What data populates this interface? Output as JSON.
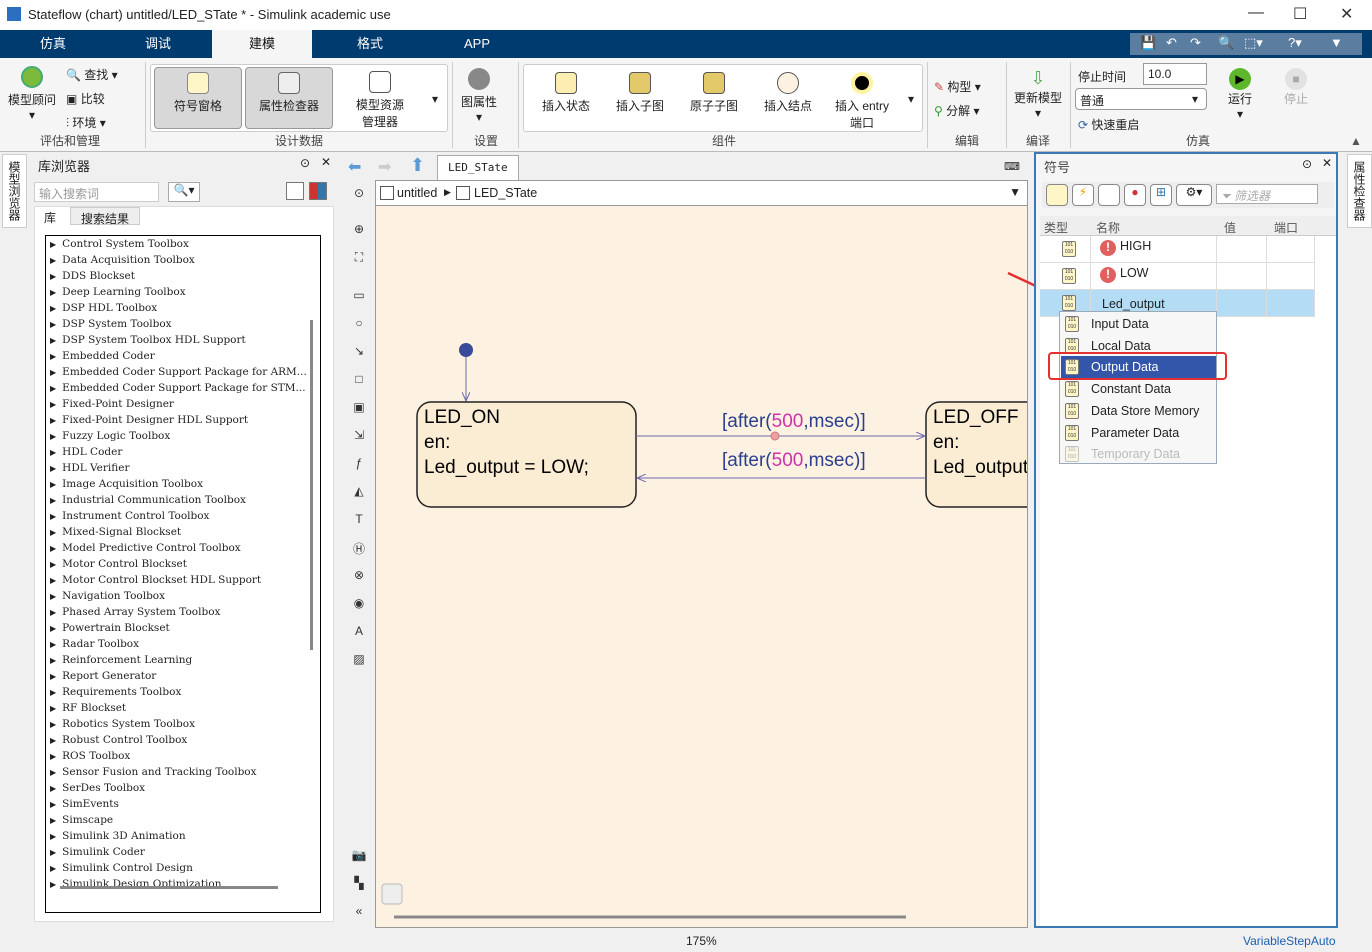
{
  "window": {
    "title": "Stateflow (chart) untitled/LED_STate * - Simulink academic use",
    "controls": [
      "minimize",
      "maximize",
      "close"
    ]
  },
  "tabs": [
    {
      "label": "仿真"
    },
    {
      "label": "调试"
    },
    {
      "label": "建模",
      "active": true
    },
    {
      "label": "格式"
    },
    {
      "label": "APP"
    }
  ],
  "ribbon": {
    "assess": {
      "advisor": "模型顾问",
      "find": "查找",
      "compare": "比较",
      "env": "环境",
      "group": "评估和管理"
    },
    "design": {
      "symbols": "符号窗格",
      "inspector": "属性检查器",
      "explorer1": "模型资源",
      "explorer2": "管理器",
      "group": "设计数据"
    },
    "setup": {
      "props": "图属性",
      "group": "设置"
    },
    "components": {
      "state": "插入状态",
      "subchart": "插入子图",
      "atomic": "原子子图",
      "junction": "插入结点",
      "entry1": "插入 entry",
      "entry2": "端口",
      "group": "组件"
    },
    "edit": {
      "pattern": "构型",
      "decompose": "分解",
      "group": "编辑"
    },
    "compile": {
      "update": "更新模型",
      "group": "编译"
    },
    "sim": {
      "stop_time_label": "停止时间",
      "stop_time": "10.0",
      "mode": "普通",
      "fast_restart": "快速重启",
      "run": "运行",
      "stop": "停止",
      "group": "仿真"
    }
  },
  "left_strip": {
    "model_browser": "模型浏览器"
  },
  "library": {
    "title": "库浏览器",
    "search_placeholder": "输入搜索词",
    "tabs": [
      "库",
      "搜索结果"
    ],
    "items": [
      "Control System Toolbox",
      "Data Acquisition Toolbox",
      "DDS Blockset",
      "Deep Learning Toolbox",
      "DSP HDL Toolbox",
      "DSP System Toolbox",
      "DSP System Toolbox HDL Support",
      "Embedded Coder",
      "Embedded Coder Support Package for ARM...",
      "Embedded Coder Support Package for STM...",
      "Fixed-Point Designer",
      "Fixed-Point Designer HDL Support",
      "Fuzzy Logic Toolbox",
      "HDL Coder",
      "HDL Verifier",
      "Image Acquisition Toolbox",
      "Industrial Communication Toolbox",
      "Instrument Control Toolbox",
      "Mixed-Signal Blockset",
      "Model Predictive Control Toolbox",
      "Motor Control Blockset",
      "Motor Control Blockset HDL Support",
      "Navigation Toolbox",
      "Phased Array System Toolbox",
      "Powertrain Blockset",
      "Radar Toolbox",
      "Reinforcement Learning",
      "Report Generator",
      "Requirements Toolbox",
      "RF Blockset",
      "Robotics System Toolbox",
      "Robust Control Toolbox",
      "ROS Toolbox",
      "Sensor Fusion and Tracking Toolbox",
      "SerDes Toolbox",
      "SimEvents",
      "Simscape",
      "Simulink 3D Animation",
      "Simulink Coder",
      "Simulink Control Design",
      "Simulink Design Optimization"
    ]
  },
  "editor": {
    "tab": "LED_STate",
    "breadcrumb": [
      "untitled",
      "LED_STate"
    ],
    "zoom": "175%",
    "states": [
      {
        "name": "LED_ON",
        "body1": "en:",
        "body2": "Led_output = LOW;"
      },
      {
        "name": "LED_OFF",
        "body1": "en:",
        "body2": "Led_output"
      }
    ],
    "transition": {
      "pre": "[after(",
      "num": "500",
      "post": ",msec)]"
    }
  },
  "symbols": {
    "title": "符号",
    "filter_placeholder": "筛选器",
    "columns": [
      "类型",
      "名称",
      "值",
      "端口"
    ],
    "rows": [
      {
        "name": "HIGH",
        "error": true
      },
      {
        "name": "LOW",
        "error": true
      },
      {
        "name": "Led_output",
        "selected": true
      }
    ],
    "menu": [
      {
        "label": "Input Data"
      },
      {
        "label": "Local Data"
      },
      {
        "label": "Output Data",
        "highlighted": true
      },
      {
        "label": "Constant Data"
      },
      {
        "label": "Data Store Memory"
      },
      {
        "label": "Parameter Data"
      },
      {
        "label": "Temporary Data",
        "disabled": true
      }
    ]
  },
  "right_strip": {
    "inspector": "属性检查器"
  },
  "status": {
    "solver": "VariableStepAuto"
  },
  "colors": {
    "tabbar": "#003b6f",
    "accent": "#3a78b6",
    "menu_highlight": "#3355aa",
    "annotation": "#e53030",
    "transition_number": "#cc33aa"
  }
}
